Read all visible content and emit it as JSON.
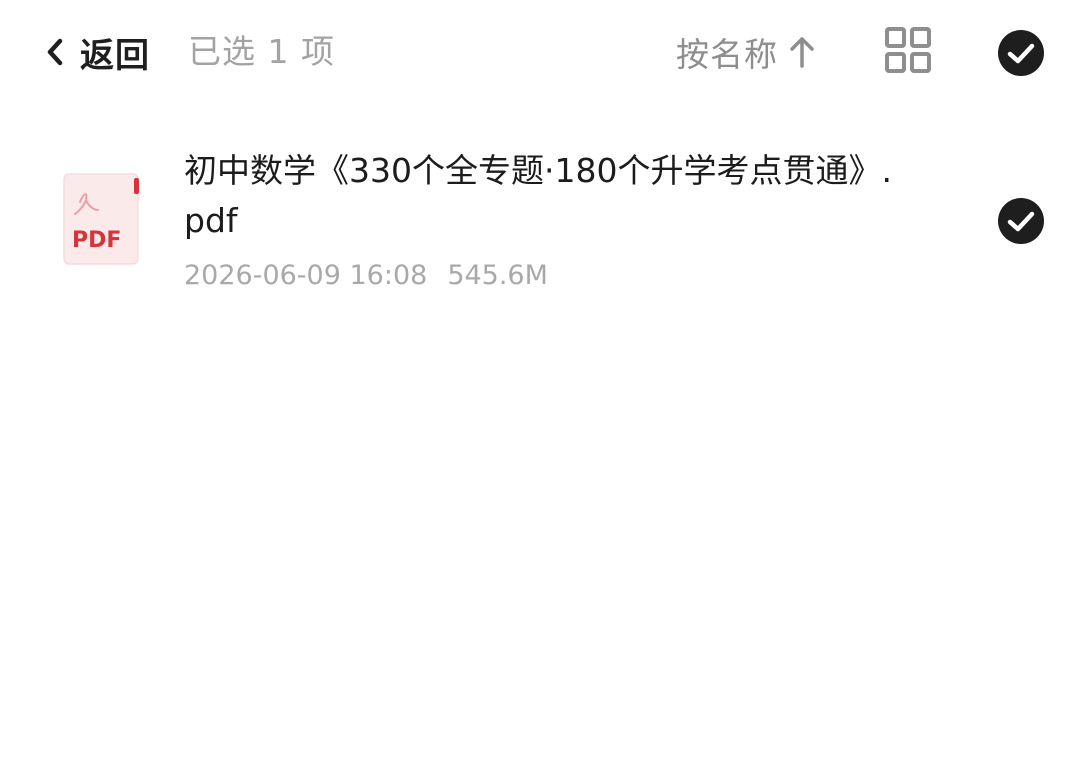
{
  "header": {
    "back_label": "返回",
    "selection_text": "已选 1 项",
    "sort_label": "按名称",
    "icons": {
      "back": "chevron-left-icon",
      "sort": "arrow-up-icon",
      "grid": "grid-view-icon",
      "select_all": "checkmark-circle-icon"
    }
  },
  "files": [
    {
      "name": "初中数学《330个全专题·180个升学考点贯通》.pdf",
      "modified": "2026-06-09 16:08",
      "size": "545.6M",
      "type_label": "PDF",
      "selected": true
    }
  ],
  "colors": {
    "primary_text": "#1c1c1c",
    "secondary_text": "#a9a9a9",
    "check_fill": "#1e1e1e",
    "pdf_red": "#d8323a",
    "pdf_bg": "#fbeaea"
  }
}
